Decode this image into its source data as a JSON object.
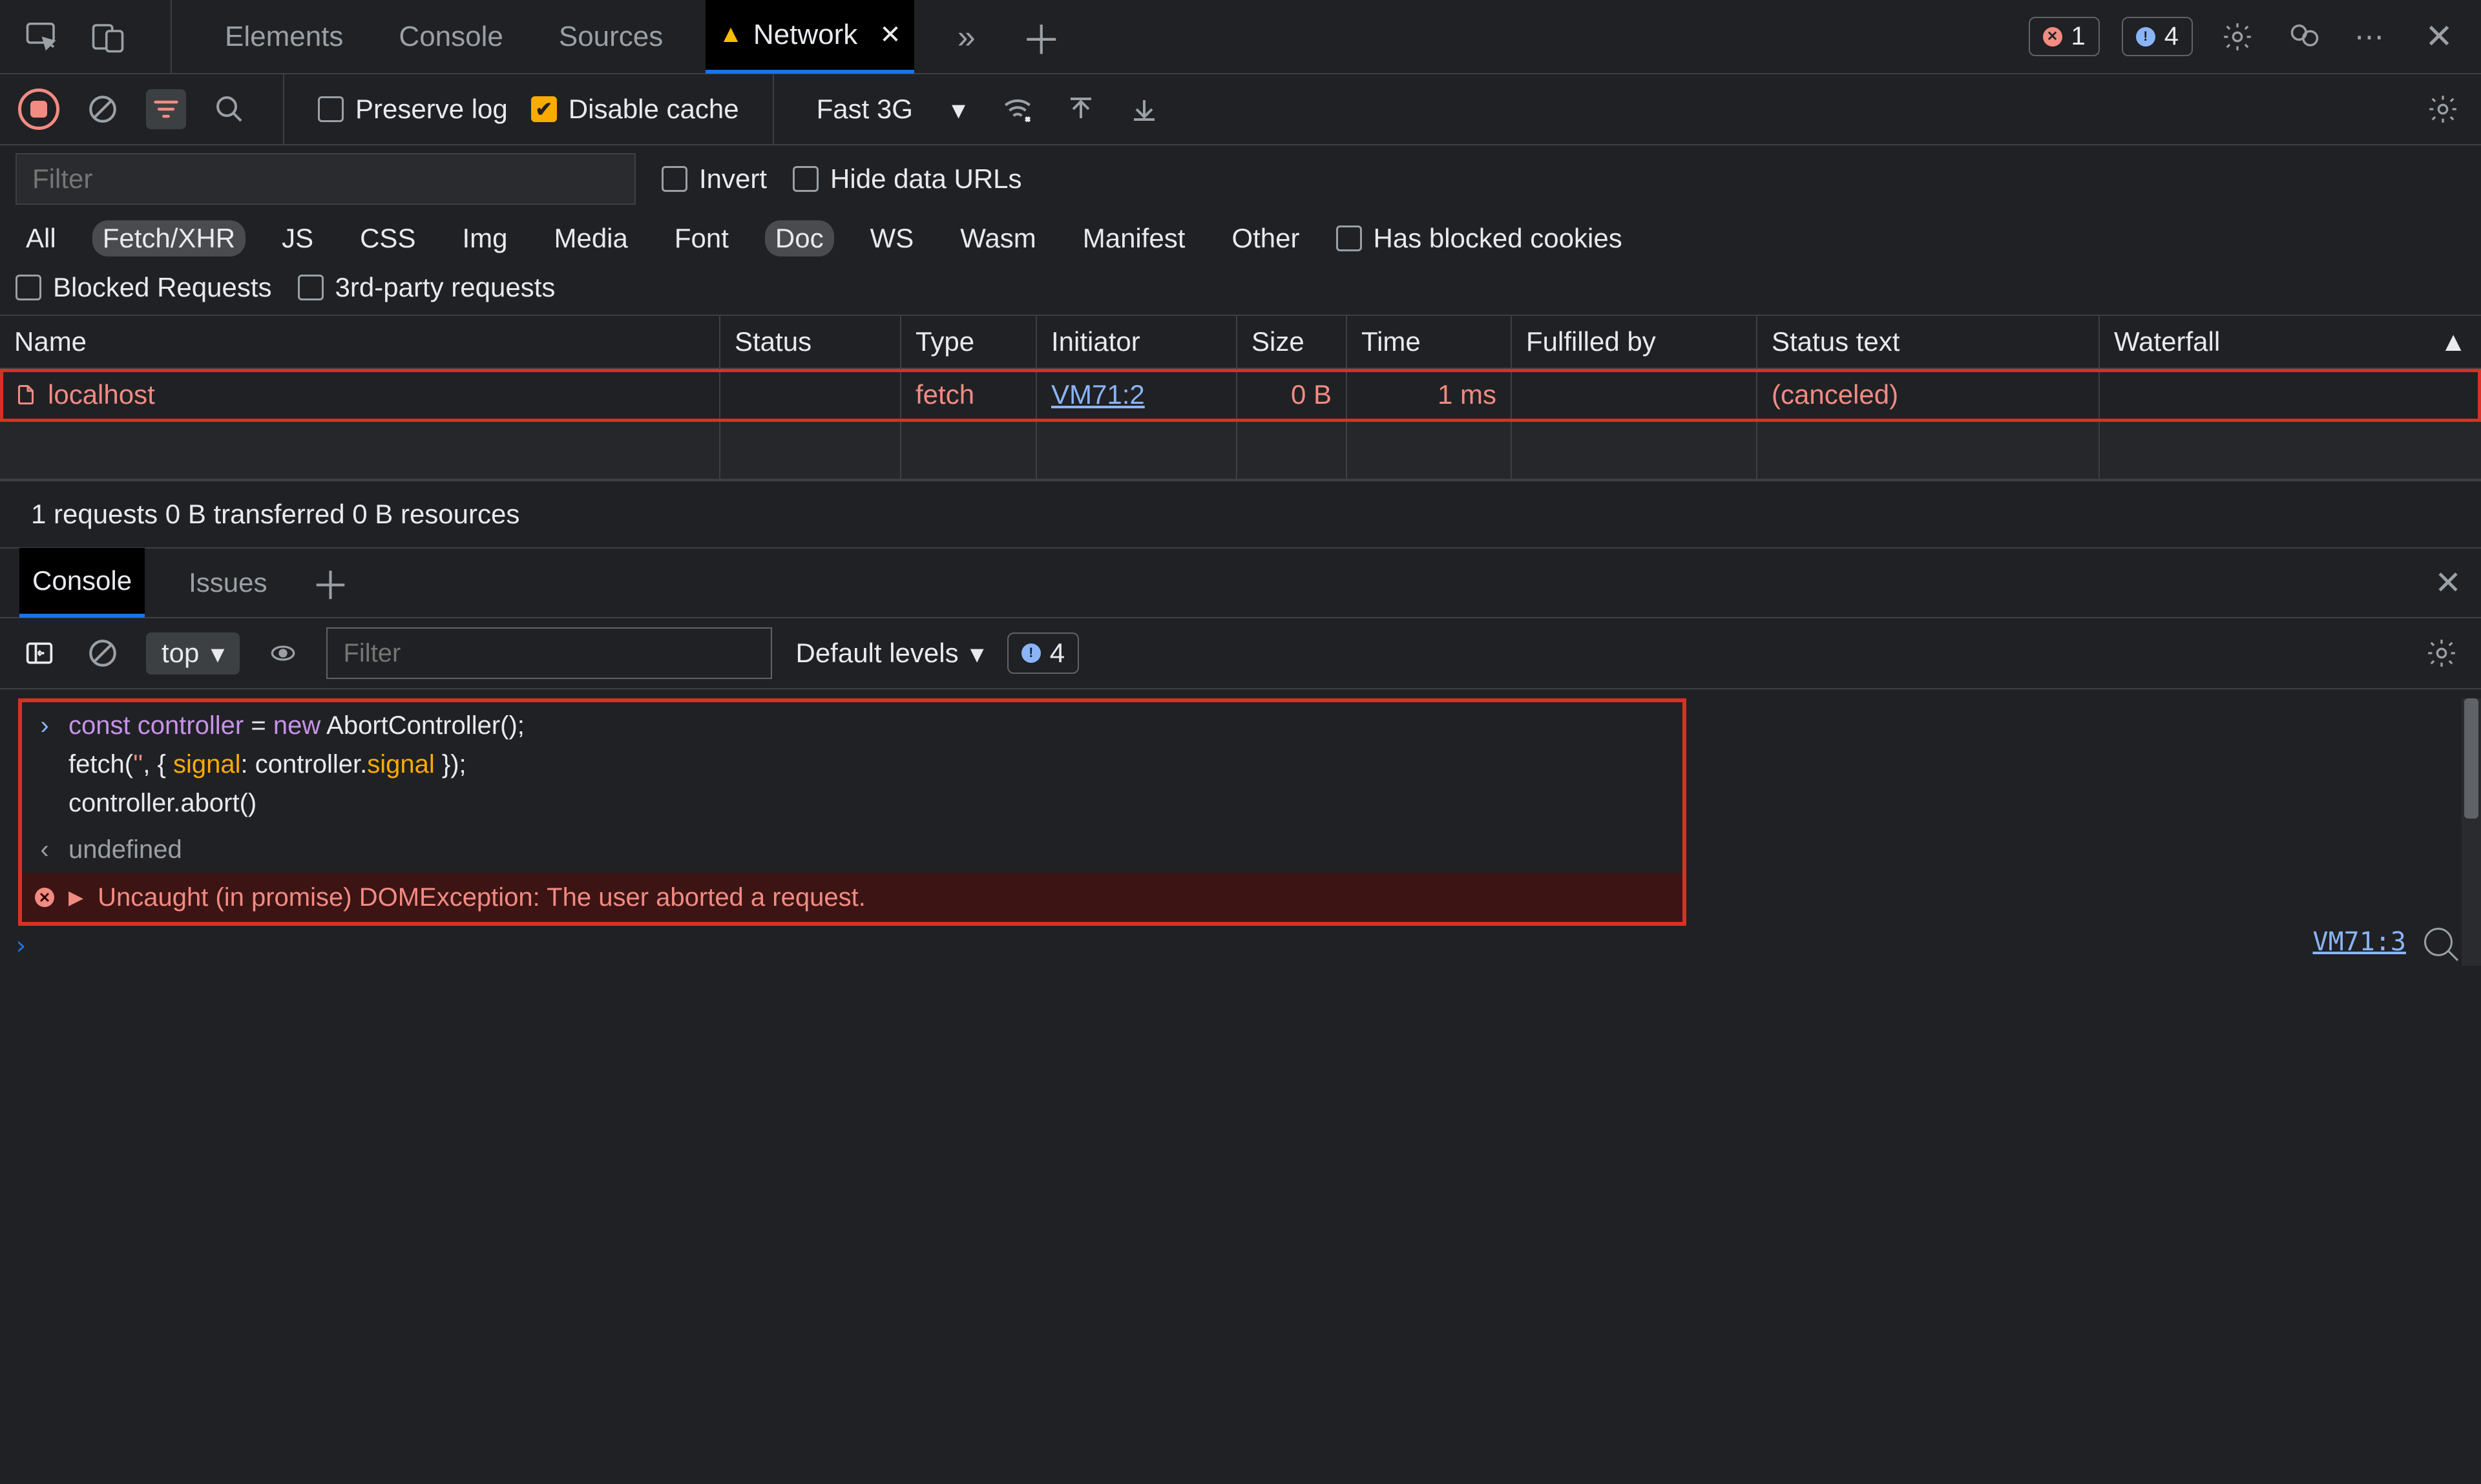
{
  "tabs": {
    "items": [
      "Elements",
      "Console",
      "Sources",
      "Network"
    ],
    "active": "Network",
    "active_has_warning": true
  },
  "topbar": {
    "errors": "1",
    "issues": "4"
  },
  "network": {
    "toolbar": {
      "preserve_log": "Preserve log",
      "disable_cache": "Disable cache",
      "throttle": "Fast 3G"
    },
    "filter": {
      "placeholder": "Filter",
      "invert": "Invert",
      "hide_data_urls": "Hide data URLs",
      "types": [
        "All",
        "Fetch/XHR",
        "JS",
        "CSS",
        "Img",
        "Media",
        "Font",
        "Doc",
        "WS",
        "Wasm",
        "Manifest",
        "Other"
      ],
      "types_selected": [
        "Fetch/XHR",
        "Doc"
      ],
      "has_blocked_cookies": "Has blocked cookies",
      "blocked_requests": "Blocked Requests",
      "third_party": "3rd-party requests"
    },
    "table": {
      "columns": [
        "Name",
        "Status",
        "Type",
        "Initiator",
        "Size",
        "Time",
        "Fulfilled by",
        "Status text",
        "Waterfall"
      ],
      "rows": [
        {
          "name": "localhost",
          "status": "",
          "type": "fetch",
          "initiator": "VM71:2",
          "size": "0 B",
          "time": "1 ms",
          "fulfilled_by": "",
          "status_text": "(canceled)",
          "error": true
        }
      ]
    },
    "status": "1 requests   0 B transferred   0 B resources"
  },
  "drawer": {
    "tabs": [
      "Console",
      "Issues"
    ],
    "active": "Console"
  },
  "console": {
    "context": "top",
    "filter_placeholder": "Filter",
    "levels": "Default levels",
    "issues_count": "4",
    "input_lines": [
      "const controller = new AbortController();",
      "fetch('', { signal: controller.signal });",
      "controller.abort()"
    ],
    "output": "undefined",
    "error": "Uncaught (in promise) DOMException: The user aborted a request.",
    "error_source": "VM71:3"
  }
}
